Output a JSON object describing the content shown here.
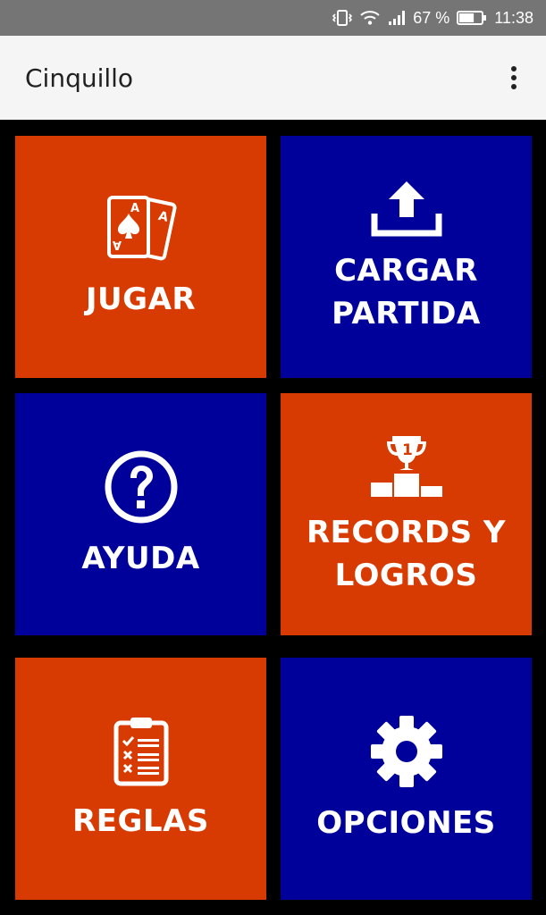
{
  "status_bar": {
    "battery_percent_label": "67 %",
    "time": "11:38",
    "icons": [
      "vibrate-icon",
      "wifi-icon",
      "signal-icon",
      "battery-icon"
    ],
    "battery_level": 0.67
  },
  "app_bar": {
    "title": "Cinquillo",
    "overflow_icon": "more-vert-icon"
  },
  "colors": {
    "orange": "#d83b01",
    "blue": "#00009b",
    "background": "#000000",
    "app_bar": "#f5f5f5",
    "status_bar": "#757575"
  },
  "tiles": [
    {
      "id": "jugar",
      "label": "JUGAR",
      "icon": "playing-cards-icon",
      "color": "orange"
    },
    {
      "id": "cargar",
      "label_line1": "CARGAR",
      "label_line2": "PARTIDA",
      "icon": "upload-icon",
      "color": "blue"
    },
    {
      "id": "ayuda",
      "label": "AYUDA",
      "icon": "help-circle-icon",
      "color": "blue"
    },
    {
      "id": "records",
      "label_line1": "RECORDS Y",
      "label_line2": "LOGROS",
      "icon": "trophy-podium-icon",
      "color": "orange"
    },
    {
      "id": "reglas",
      "label": "REGLAS",
      "icon": "clipboard-checklist-icon",
      "color": "orange"
    },
    {
      "id": "opciones",
      "label": "OPCIONES",
      "icon": "gear-icon",
      "color": "blue"
    }
  ]
}
